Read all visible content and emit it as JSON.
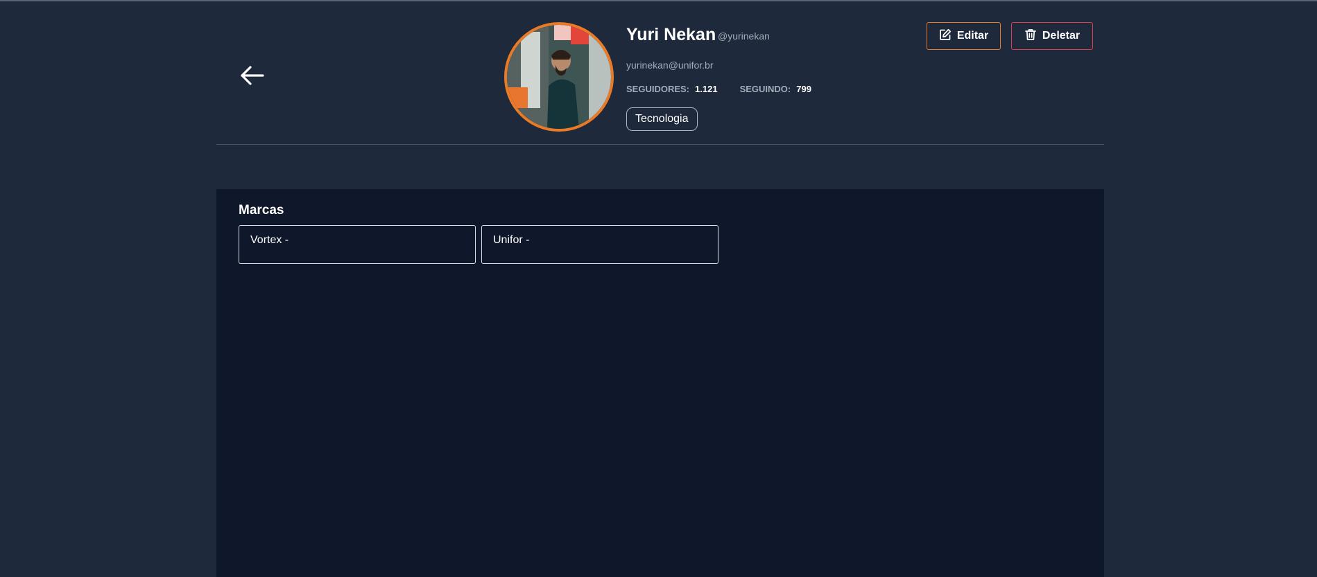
{
  "nav": {
    "back_icon": "arrow-left-icon"
  },
  "profile": {
    "name": "Yuri Nekan",
    "handle": "@yurinekan",
    "email": "yurinekan@unifor.br",
    "followers_label": "SEGUIDORES:",
    "followers_value": "1.121",
    "following_label": "SEGUINDO:",
    "following_value": "799",
    "tag": "Tecnologia",
    "avatar_border_color": "#ea7a25"
  },
  "actions": {
    "edit_label": "Editar",
    "edit_icon": "pencil-square-icon",
    "edit_color": "#ea7a25",
    "delete_label": "Deletar",
    "delete_icon": "trash-icon",
    "delete_color": "#e03e48"
  },
  "brands": {
    "title": "Marcas",
    "items": [
      {
        "label": "Vortex -"
      },
      {
        "label": "Unifor -"
      }
    ]
  }
}
